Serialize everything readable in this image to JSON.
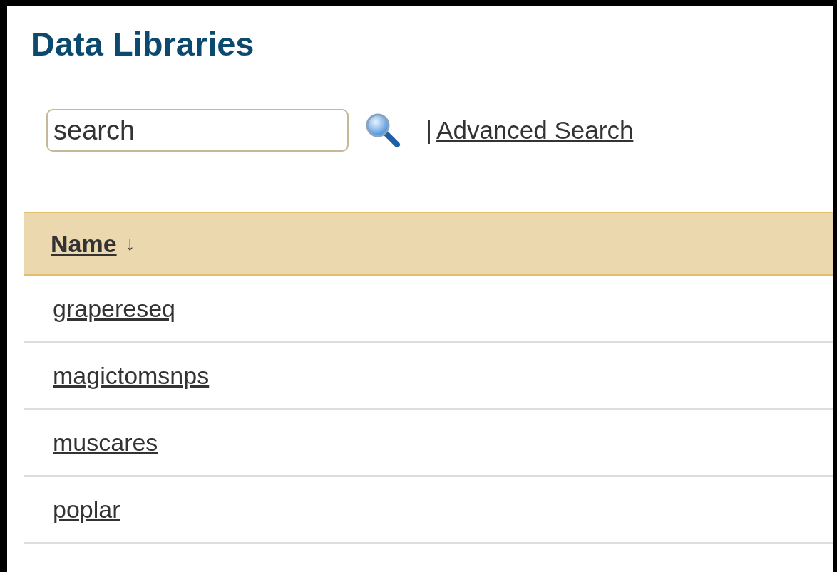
{
  "title": "Data Libraries",
  "search": {
    "value": "search",
    "separator": "|",
    "advanced_link": "Advanced Search"
  },
  "table": {
    "columns": [
      {
        "label": "Name",
        "sort_indicator": "↓"
      }
    ],
    "rows": [
      {
        "name": "grapereseq"
      },
      {
        "name": "magictomsnps"
      },
      {
        "name": "muscares"
      },
      {
        "name": "poplar"
      }
    ]
  }
}
